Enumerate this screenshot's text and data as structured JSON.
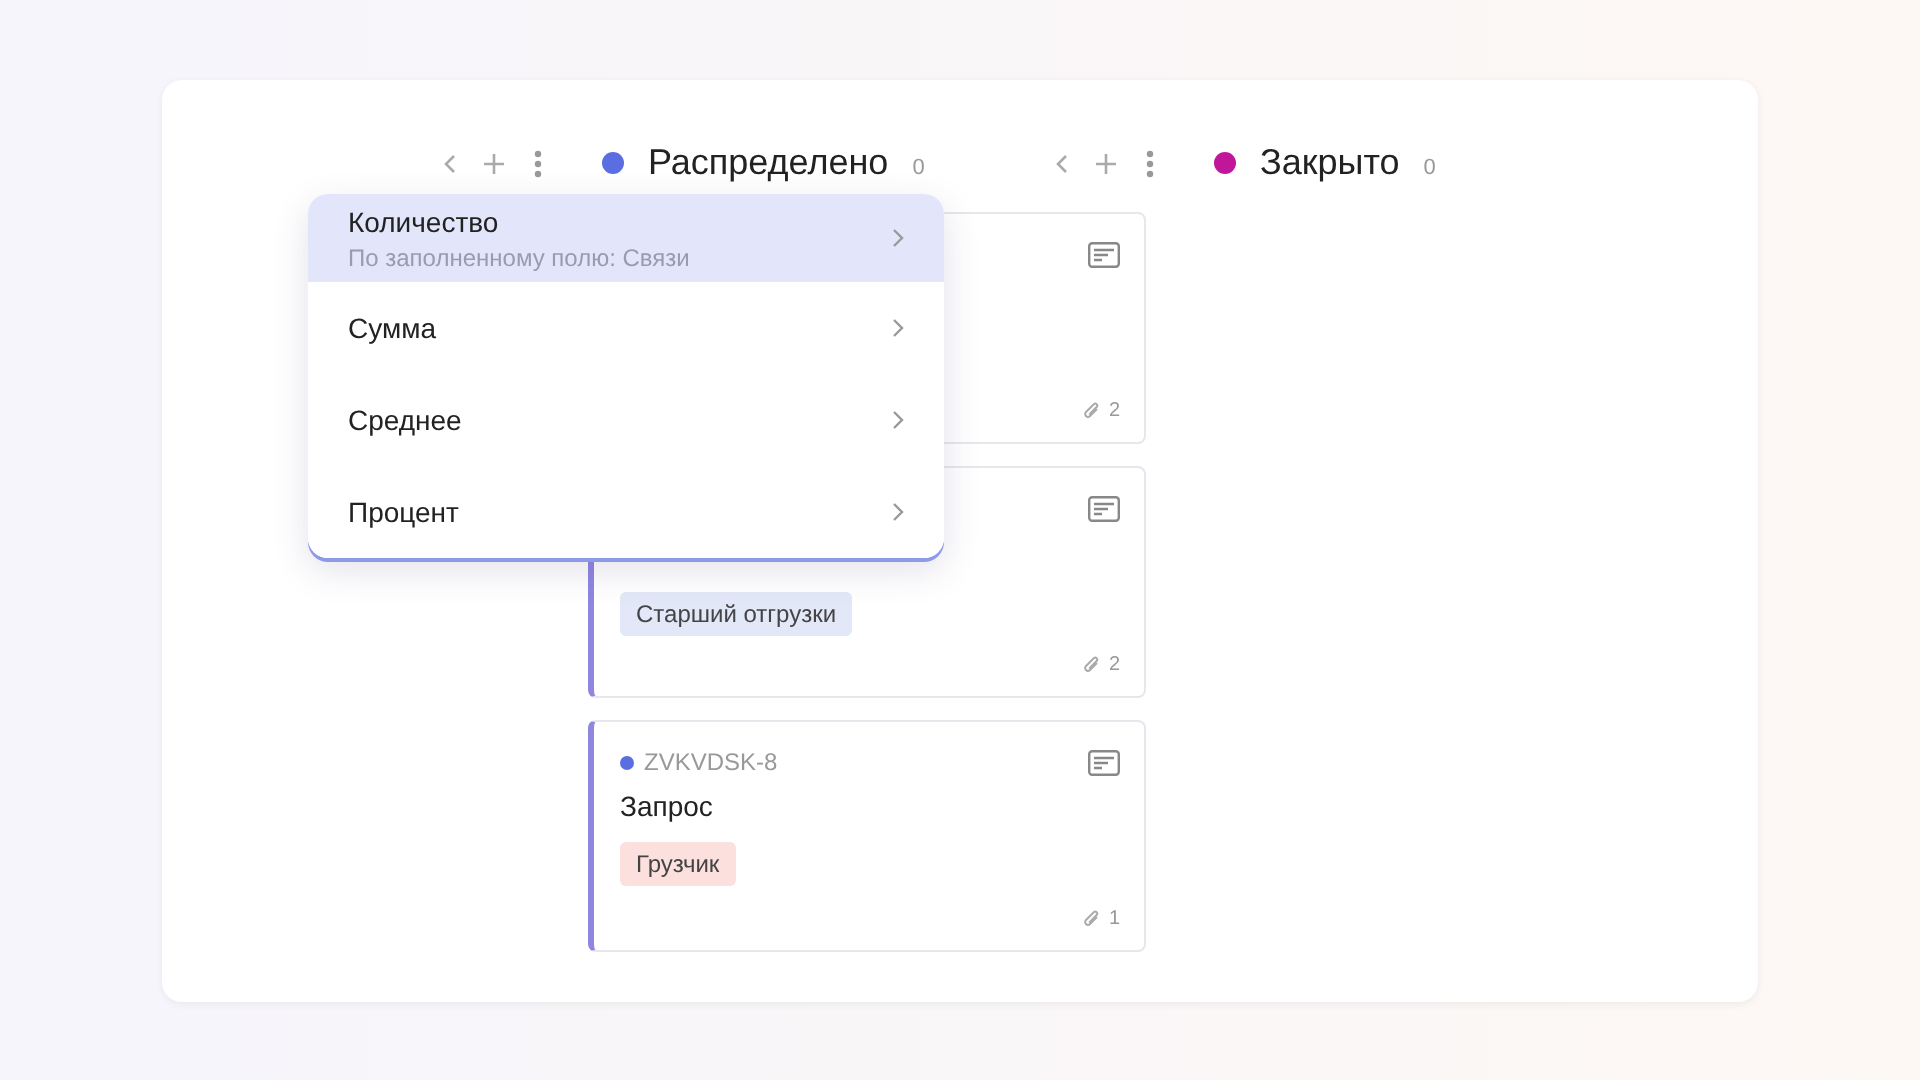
{
  "columns": [
    {
      "title": "Распределено",
      "count": "0",
      "color": "#5b6ee1",
      "cards": [
        {
          "attachments": "2"
        },
        {
          "accent": true,
          "tag": {
            "label": "Старший отгрузки",
            "color": "#e3e8f8"
          },
          "attachments": "2"
        },
        {
          "accent": true,
          "id": "ZVKVDSK-8",
          "title": "Запрос",
          "tag": {
            "label": "Грузчик",
            "color": "#fbe0dd"
          },
          "attachments": "1"
        }
      ]
    },
    {
      "title": "Закрыто",
      "count": "0",
      "color": "#c0169a"
    }
  ],
  "menu": {
    "items": [
      {
        "label": "Количество",
        "hint": "По заполненному полю: Связи",
        "selected": true
      },
      {
        "label": "Сумма",
        "selected": false
      },
      {
        "label": "Среднее",
        "selected": false
      },
      {
        "label": "Процент",
        "selected": false
      }
    ]
  }
}
